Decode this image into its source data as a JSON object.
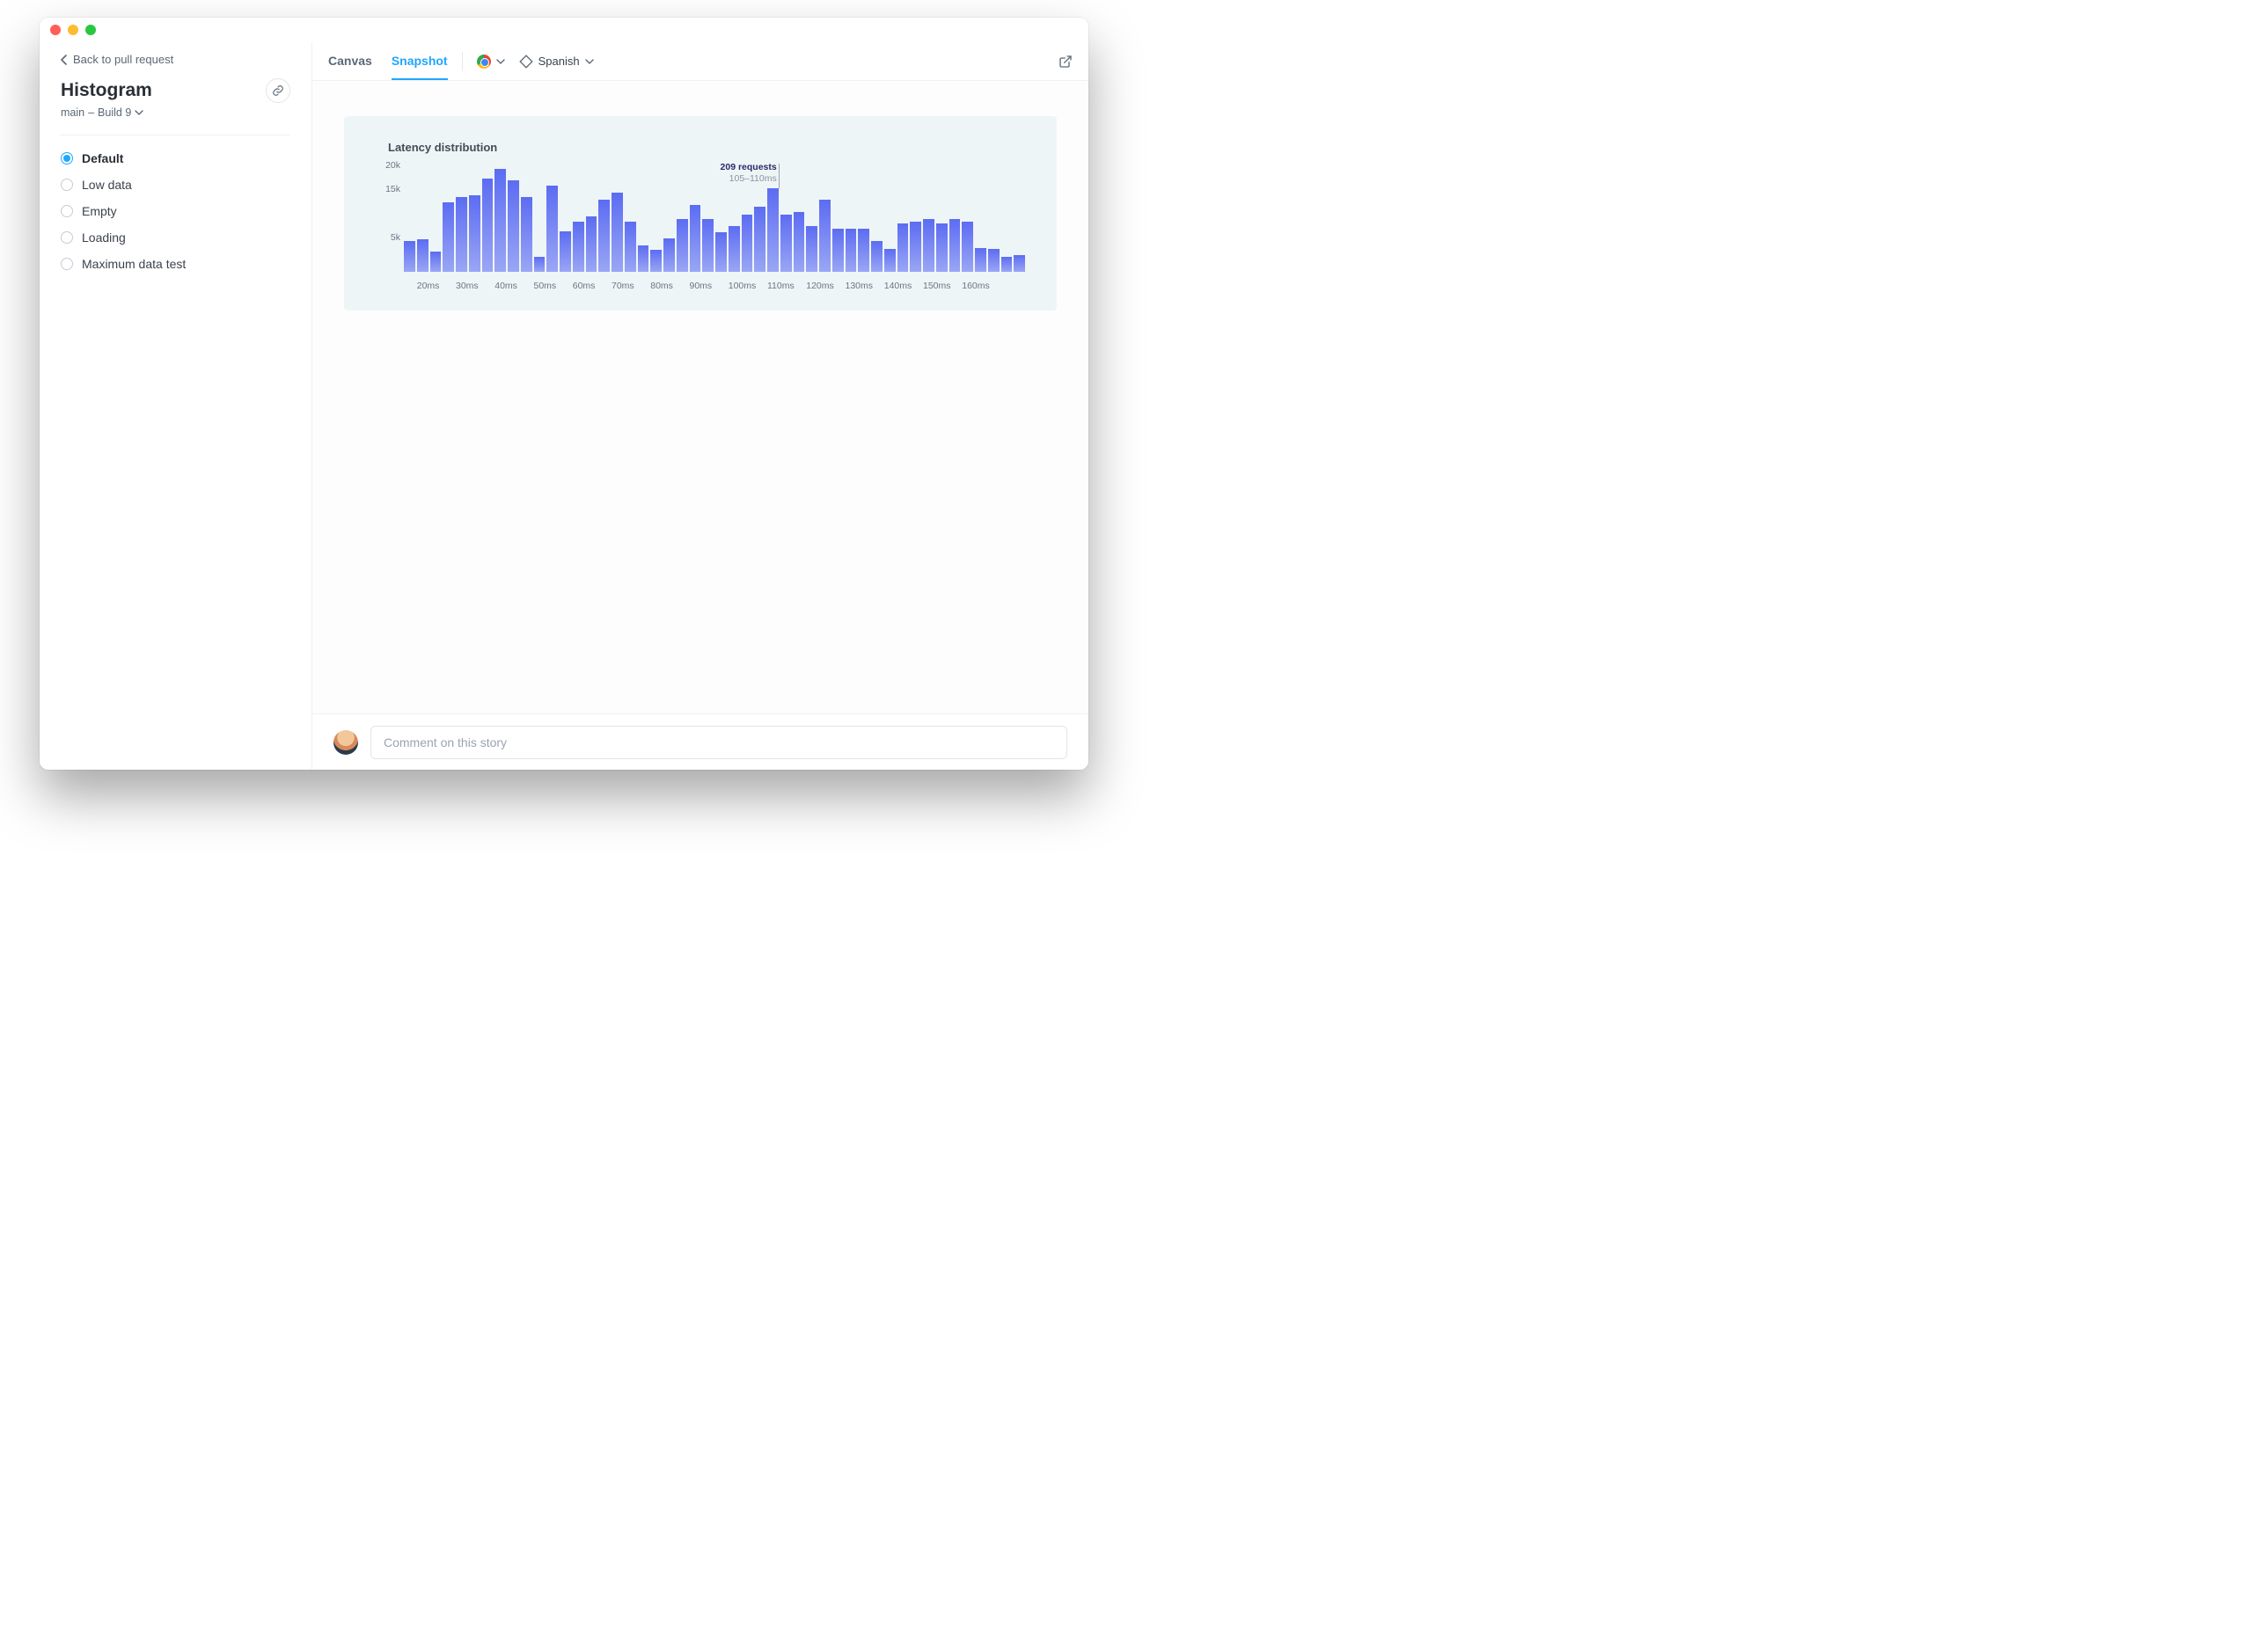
{
  "sidebar": {
    "back_label": "Back to pull request",
    "title": "Histogram",
    "branch": "main",
    "build_label": "Build 9",
    "stories": [
      {
        "label": "Default",
        "selected": true
      },
      {
        "label": "Low data",
        "selected": false
      },
      {
        "label": "Empty",
        "selected": false
      },
      {
        "label": "Loading",
        "selected": false
      },
      {
        "label": "Maximum data test",
        "selected": false
      }
    ]
  },
  "toolbar": {
    "tabs": [
      {
        "label": "Canvas",
        "active": false
      },
      {
        "label": "Snapshot",
        "active": true
      }
    ],
    "browser_label": "Chrome",
    "language_label": "Spanish"
  },
  "comment": {
    "placeholder": "Comment on this story"
  },
  "chart_data": {
    "type": "bar",
    "title": "Latency distribution",
    "ylabel": "",
    "xlabel": "",
    "ylim": [
      0,
      22000
    ],
    "yticks": [
      {
        "v": 20000,
        "label": "20k"
      },
      {
        "v": 15000,
        "label": "15k"
      },
      {
        "v": 5000,
        "label": "5k"
      }
    ],
    "categories_labels": [
      "20ms",
      "30ms",
      "40ms",
      "50ms",
      "60ms",
      "70ms",
      "80ms",
      "90ms",
      "100ms",
      "110ms",
      "120ms",
      "130ms",
      "140ms",
      "150ms",
      "160ms"
    ],
    "x_label_every": 3,
    "values": [
      6500,
      6800,
      4200,
      14500,
      15500,
      16000,
      19500,
      21500,
      19000,
      15500,
      3200,
      18000,
      8500,
      10500,
      11500,
      15000,
      16500,
      10500,
      5500,
      4500,
      7000,
      11000,
      14000,
      11000,
      8200,
      9500,
      12000,
      13500,
      17500,
      12000,
      12500,
      9500,
      15000,
      9000,
      9000,
      9000,
      6500,
      4800,
      10000,
      10500,
      11000,
      10000,
      11000,
      10500,
      5000,
      4700,
      3200,
      3500
    ],
    "tooltip": {
      "index": 28,
      "line1": "209 requests",
      "line2": "105–110ms"
    }
  }
}
